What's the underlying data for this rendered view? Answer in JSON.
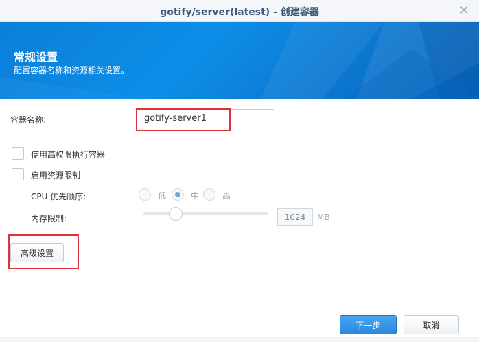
{
  "window": {
    "title": "gotify/server(latest) - 创建容器"
  },
  "banner": {
    "title": "常规设置",
    "subtitle": "配置容器名称和资源相关设置。"
  },
  "form": {
    "container_name_label": "容器名称:",
    "container_name_value": "gotify-server1",
    "privileged_label": "使用高权限执行容器",
    "resource_limit_label": "启用资源限制",
    "cpu_priority_label": "CPU 优先顺序:",
    "cpu_options": [
      {
        "label": "低",
        "selected": false
      },
      {
        "label": "中",
        "selected": true
      },
      {
        "label": "高",
        "selected": false
      }
    ],
    "memory_limit_label": "内存限制:",
    "memory_value": "1024",
    "memory_unit": "MB",
    "advanced_label": "高级设置"
  },
  "footer": {
    "next_label": "下一步",
    "cancel_label": "取消"
  },
  "colors": {
    "accent": "#2a88e0",
    "banner": "#0d8ee8",
    "highlight": "#e0303a"
  },
  "icons": {
    "close": "close-icon"
  }
}
